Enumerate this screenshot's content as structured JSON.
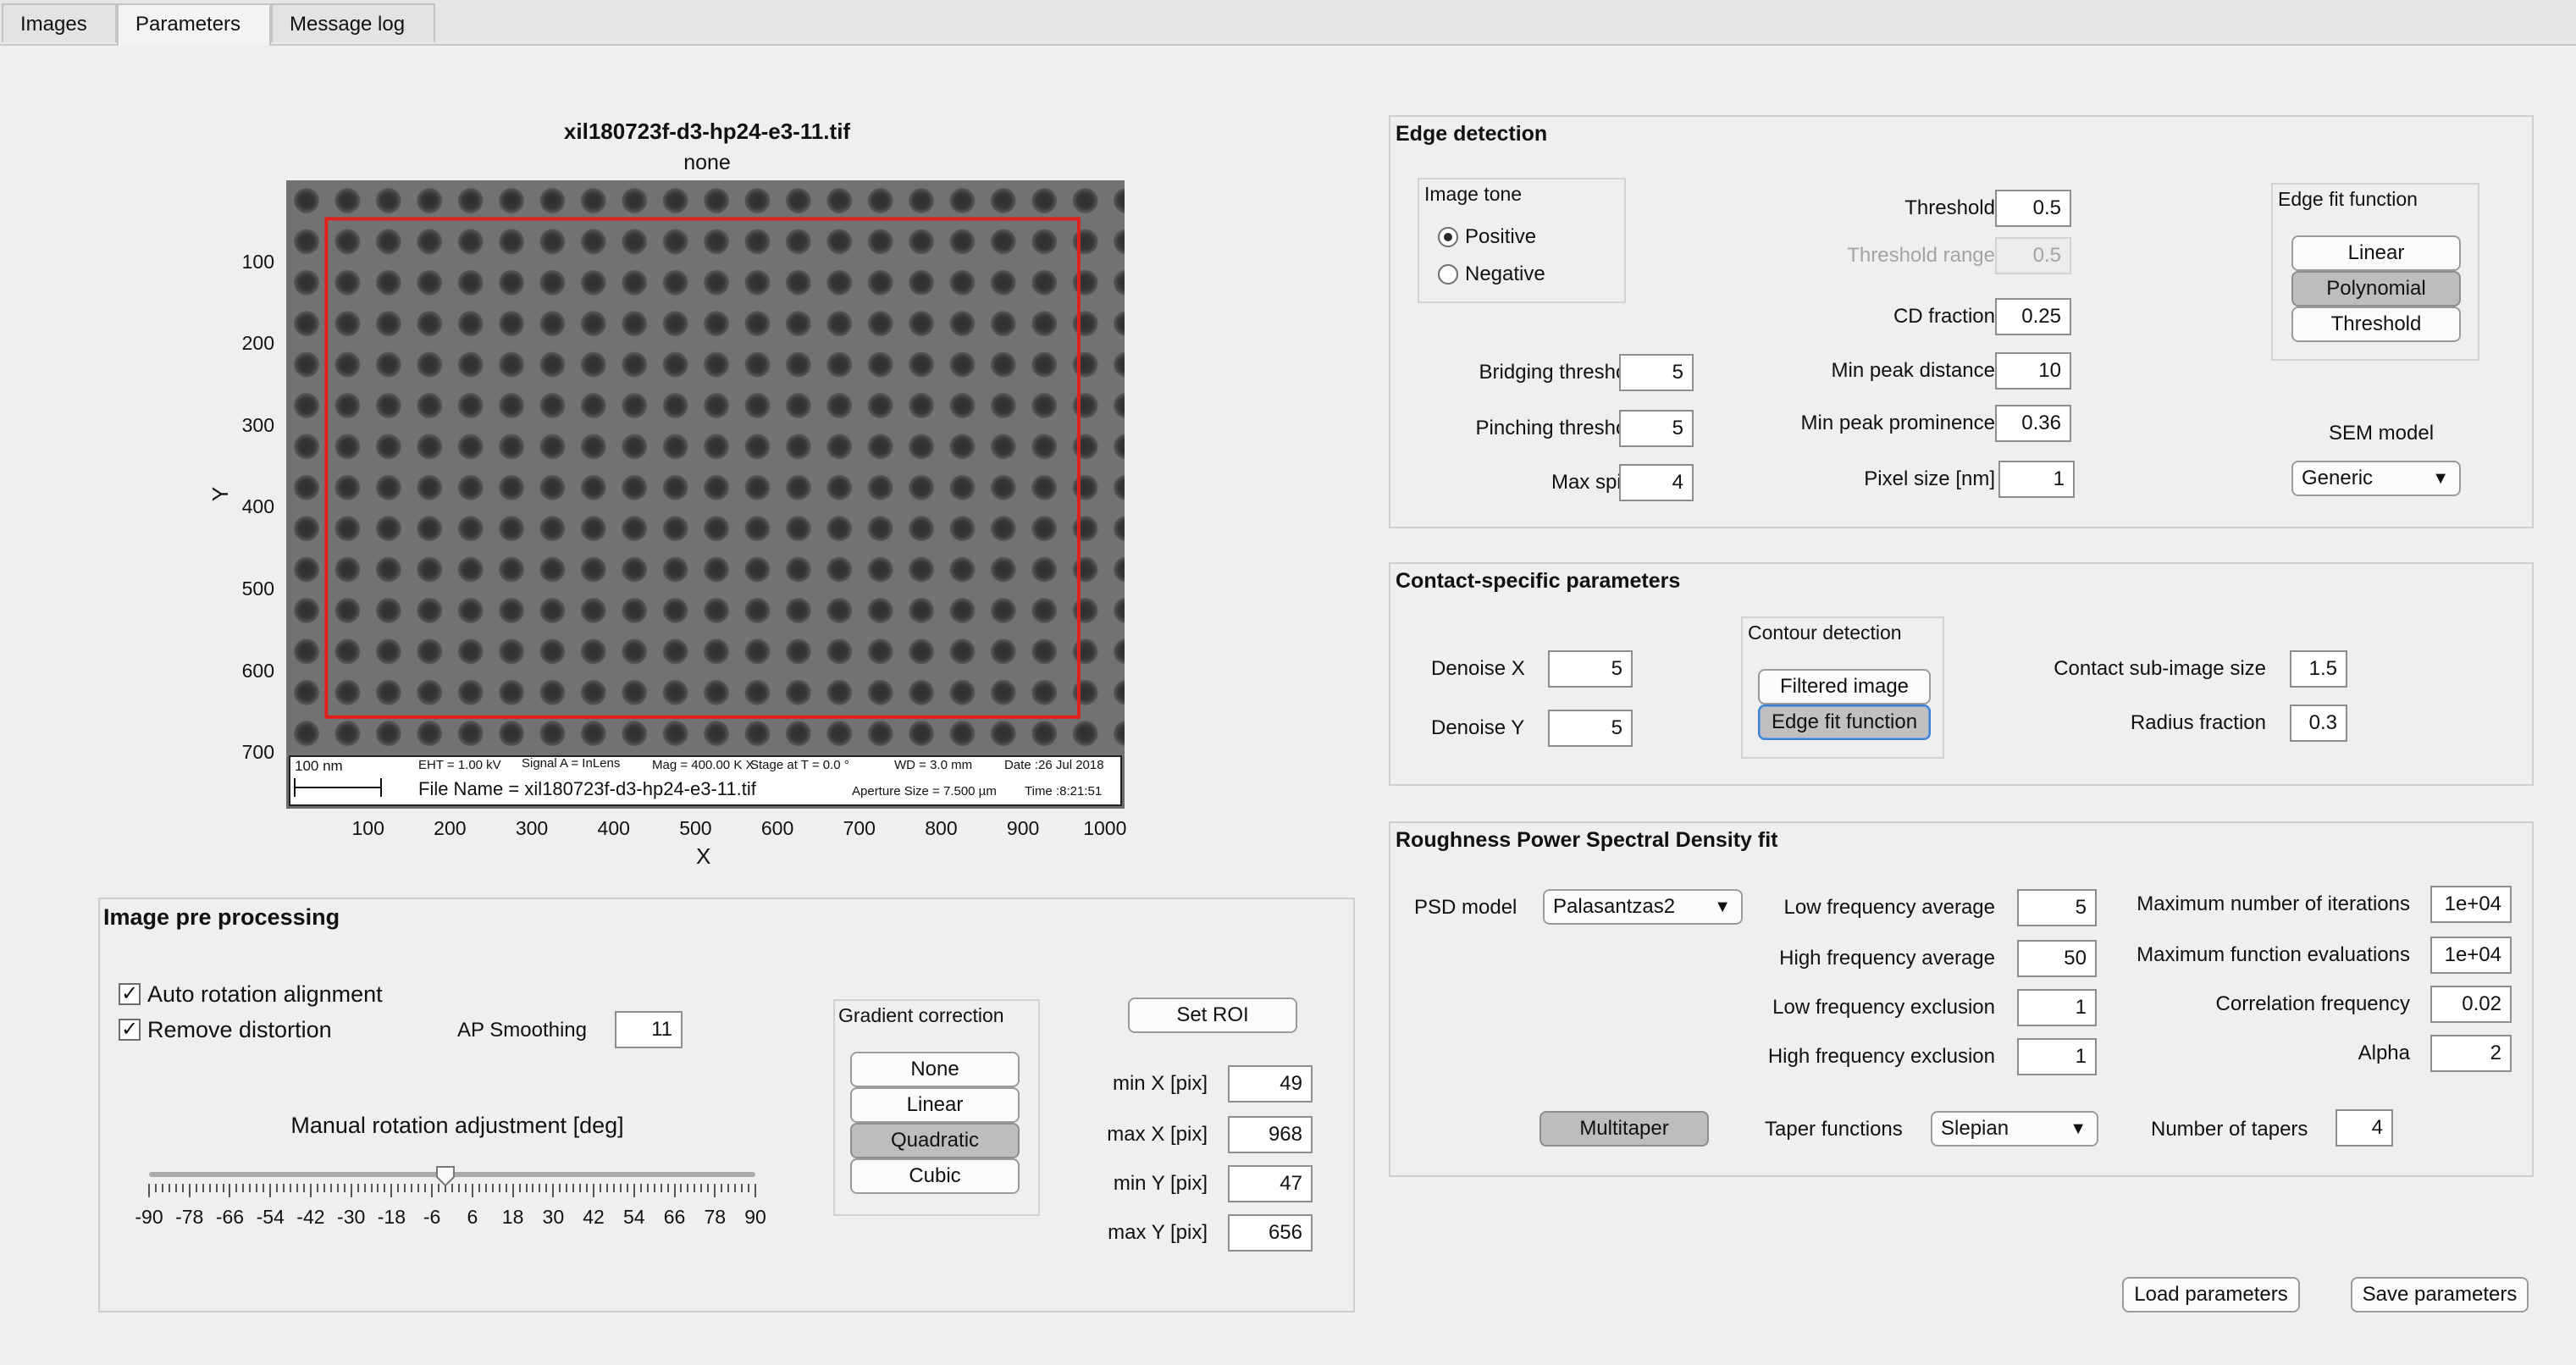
{
  "tabs": [
    "Images",
    "Parameters",
    "Message log"
  ],
  "active_tab": "Parameters",
  "image_plot": {
    "title": "xil180723f-d3-hp24-e3-11.tif",
    "subtitle": "none",
    "xlabel": "X",
    "ylabel": "Y",
    "xticks": [
      "100",
      "200",
      "300",
      "400",
      "500",
      "600",
      "700",
      "800",
      "900",
      "1000"
    ],
    "yticks": [
      "100",
      "200",
      "300",
      "400",
      "500",
      "600",
      "700"
    ],
    "roi_rect": {
      "xmin": 49,
      "xmax": 968,
      "ymin": 47,
      "ymax": 656
    },
    "roi_color": "#e0201a",
    "sem_info": {
      "scale": "100 nm",
      "eht": "EHT =  1.00 kV",
      "signal": "Signal A = InLens",
      "mag": "Mag =  400.00 K X",
      "stage": "Stage at T =   0.0 °",
      "wd": "WD =  3.0 mm",
      "date": "Date :26 Jul 2018",
      "filename": "File Name = xil180723f-d3-hp24-e3-11.tif",
      "aperture": "Aperture Size = 7.500 µm",
      "time": "Time :8:21:51"
    }
  },
  "preproc": {
    "title": "Image pre processing",
    "auto_rotation": {
      "label": "Auto rotation alignment",
      "checked": true
    },
    "remove_distortion": {
      "label": "Remove distortion",
      "checked": true
    },
    "ap_smoothing": {
      "label": "AP Smoothing",
      "value": "11"
    },
    "slider": {
      "label": "Manual rotation adjustment [deg]",
      "value": -2,
      "min": -90,
      "max": 90,
      "ticks": [
        "-90",
        "-78",
        "-66",
        "-54",
        "-42",
        "-30",
        "-18",
        "-6",
        "6",
        "18",
        "30",
        "42",
        "54",
        "66",
        "78",
        "90"
      ]
    },
    "gradient": {
      "title": "Gradient correction",
      "options": [
        "None",
        "Linear",
        "Quadratic",
        "Cubic"
      ],
      "selected": "Quadratic"
    },
    "set_roi": "Set ROI",
    "minx": {
      "label": "min X [pix]",
      "value": "49"
    },
    "maxx": {
      "label": "max X [pix]",
      "value": "968"
    },
    "miny": {
      "label": "min Y [pix]",
      "value": "47"
    },
    "maxy": {
      "label": "max Y [pix]",
      "value": "656"
    }
  },
  "edge": {
    "title": "Edge detection",
    "tone": {
      "title": "Image tone",
      "options": [
        "Positive",
        "Negative"
      ],
      "selected": "Positive"
    },
    "threshold": {
      "label": "Threshold",
      "value": "0.5"
    },
    "threshold_range": {
      "label": "Threshold range",
      "value": "0.5"
    },
    "cd_fraction": {
      "label": "CD fraction",
      "value": "0.25"
    },
    "min_peak_distance": {
      "label": "Min peak distance",
      "value": "10"
    },
    "min_peak_prominence": {
      "label": "Min peak prominence",
      "value": "0.36"
    },
    "pixel_size": {
      "label": "Pixel size [nm]",
      "value": "1"
    },
    "bridging": {
      "label": "Bridging threshold",
      "value": "5"
    },
    "pinching": {
      "label": "Pinching threshold",
      "value": "5"
    },
    "max_spike": {
      "label": "Max spike",
      "value": "4"
    },
    "fit": {
      "title": "Edge fit function",
      "options": [
        "Linear",
        "Polynomial",
        "Threshold"
      ],
      "selected": "Polynomial"
    },
    "sem_model": {
      "label": "SEM model",
      "value": "Generic"
    }
  },
  "contact": {
    "title": "Contact-specific parameters",
    "denoise_x": {
      "label": "Denoise X",
      "value": "5"
    },
    "denoise_y": {
      "label": "Denoise Y",
      "value": "5"
    },
    "contour": {
      "title": "Contour detection",
      "options": [
        "Filtered image",
        "Edge fit function"
      ],
      "selected": "Edge fit function"
    },
    "sub_image": {
      "label": "Contact sub-image size",
      "value": "1.5"
    },
    "radius": {
      "label": "Radius fraction",
      "value": "0.3"
    }
  },
  "psd": {
    "title": "Roughness Power Spectral Density fit",
    "model": {
      "label": "PSD model",
      "value": "Palasantzas2"
    },
    "low_avg": {
      "label": "Low frequency average",
      "value": "5"
    },
    "high_avg": {
      "label": "High frequency average",
      "value": "50"
    },
    "low_excl": {
      "label": "Low frequency exclusion",
      "value": "1"
    },
    "high_excl": {
      "label": "High frequency exclusion",
      "value": "1"
    },
    "max_iter": {
      "label": "Maximum number of iterations",
      "value": "1e+04"
    },
    "max_eval": {
      "label": "Maximum function evaluations",
      "value": "1e+04"
    },
    "corr_freq": {
      "label": "Correlation frequency",
      "value": "0.02"
    },
    "alpha": {
      "label": "Alpha",
      "value": "2"
    },
    "multitaper": "Multitaper",
    "taper_fn": {
      "label": "Taper functions",
      "value": "Slepian"
    },
    "num_tapers": {
      "label": "Number of tapers",
      "value": "4"
    }
  },
  "load_params": "Load parameters",
  "save_params": "Save parameters"
}
